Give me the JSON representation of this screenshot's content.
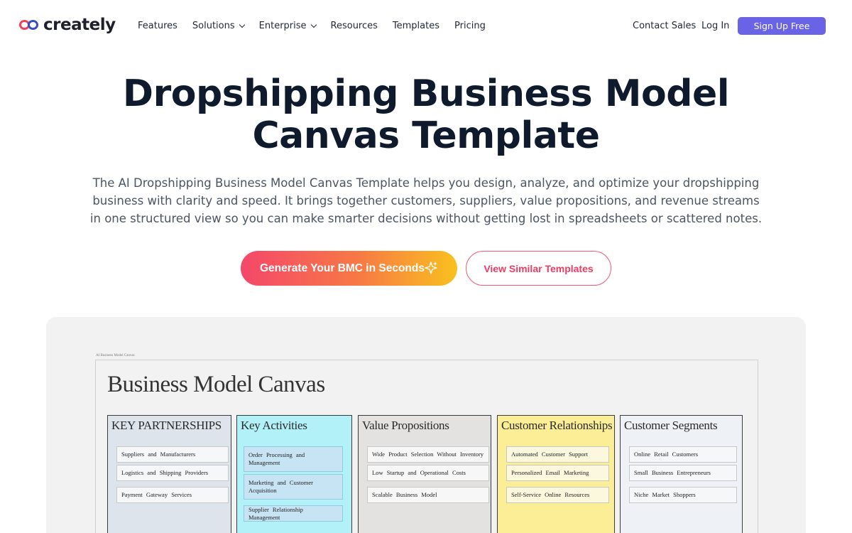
{
  "nav": {
    "logo_text": "creately",
    "links": [
      "Features",
      "Solutions",
      "Enterprise",
      "Resources",
      "Templates",
      "Pricing"
    ],
    "contact_sales": "Contact Sales",
    "login": "Log In",
    "signup": "Sign Up Free"
  },
  "hero": {
    "title_line1": "Dropshipping Business Model",
    "title_line2": "Canvas Template",
    "description": "The AI Dropshipping Business Model Canvas Template helps you design, analyze, and optimize your dropshipping business with clarity and speed. It brings together customers, suppliers, value propositions, and revenue streams in one structured view so you can make smarter decisions without getting lost in spreadsheets or scattered notes.",
    "generate_button": "Generate Your BMC in Seconds",
    "view_button": "View Similar Templates"
  },
  "preview": {
    "caption": "AI Business Model Canvas",
    "canvas_title": "Business Model Canvas",
    "columns": [
      {
        "title": "KEY PARTNERSHIPS",
        "items": [
          "Suppliers and Manufacturers",
          "Logistics and Shipping Providers",
          "Payment Gateway Services"
        ]
      },
      {
        "title": "Key Activities",
        "items": [
          "Order Processing and Management",
          "Marketing and Customer Acquisition",
          "Supplier Relationship Management"
        ]
      },
      {
        "title": "Value Propositions",
        "items": [
          "Wide Product Selection Without Inventory",
          "Low Startup and Operational Costs",
          "Scalable Business Model"
        ]
      },
      {
        "title": "Customer Relationships",
        "items": [
          "Automated Customer Support",
          "Personalized Email Marketing",
          "Self-Service Online Resources"
        ]
      },
      {
        "title": "Customer Segments",
        "items": [
          "Online Retail Customers",
          "Small Business Entrepreneurs",
          "Niche Market Shoppers"
        ]
      }
    ]
  },
  "colors": {
    "brand_purple": "#6a63e6",
    "gradient_start": "#f4476a",
    "gradient_end": "#f9c11e",
    "accent_pink": "#ee3b62"
  },
  "icons": [
    "creately-logo-icon",
    "chevron-down-icon",
    "sparkle-icon"
  ]
}
